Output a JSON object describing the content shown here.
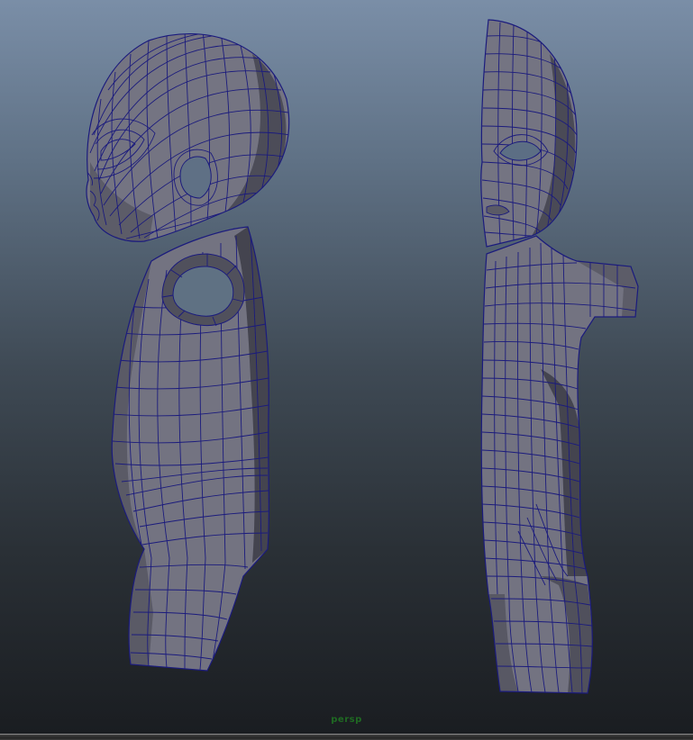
{
  "viewport": {
    "camera_label": "persp"
  },
  "colors": {
    "background_top": "#7a8ea7",
    "background_bottom": "#1a1d21",
    "mesh_fill": "#737380",
    "mesh_shadow": "#45454f",
    "mesh_highlight": "#8a8a95",
    "wireframe": "#1a1a7a",
    "camera_label": "#1f6a22"
  }
}
